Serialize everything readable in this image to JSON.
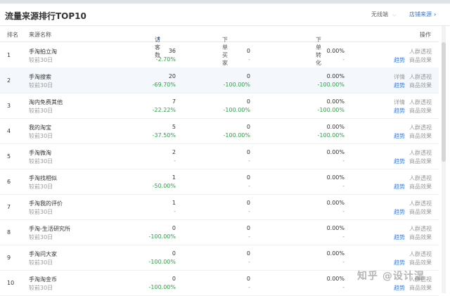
{
  "header": {
    "title": "流量来源排行TOP10",
    "device_select": "无线端",
    "shop_source_link": "店铺来源"
  },
  "columns": {
    "rank": "排名",
    "source": "来源名称",
    "visitors": "访客数",
    "buyers": "下单买家数",
    "conversion": "下单转化率",
    "action": "操作"
  },
  "actions": {
    "detail": "详情",
    "trend": "趋势",
    "crowd": "人群透视",
    "effect": "商品效果"
  },
  "compare_label": "较前30日",
  "rows": [
    {
      "rank": "1",
      "name": "手淘拍立淘",
      "visitors": "36",
      "visitors_chg": "-2.70%",
      "buyers": "0",
      "buyers_chg": "-",
      "conv": "0.00%",
      "conv_chg": "-",
      "has_detail": false
    },
    {
      "rank": "2",
      "name": "手淘搜索",
      "visitors": "20",
      "visitors_chg": "-69.70%",
      "buyers": "0",
      "buyers_chg": "-100.00%",
      "conv": "0.00%",
      "conv_chg": "-100.00%",
      "has_detail": true
    },
    {
      "rank": "3",
      "name": "淘内免费其他",
      "visitors": "7",
      "visitors_chg": "-22.22%",
      "buyers": "0",
      "buyers_chg": "-100.00%",
      "conv": "0.00%",
      "conv_chg": "-100.00%",
      "has_detail": true
    },
    {
      "rank": "4",
      "name": "我的淘宝",
      "visitors": "5",
      "visitors_chg": "-37.50%",
      "buyers": "0",
      "buyers_chg": "-100.00%",
      "conv": "0.00%",
      "conv_chg": "-100.00%",
      "has_detail": false
    },
    {
      "rank": "5",
      "name": "手淘微淘",
      "visitors": "2",
      "visitors_chg": "-",
      "buyers": "0",
      "buyers_chg": "-",
      "conv": "0.00%",
      "conv_chg": "-",
      "has_detail": false
    },
    {
      "rank": "6",
      "name": "手淘找相似",
      "visitors": "1",
      "visitors_chg": "-50.00%",
      "buyers": "0",
      "buyers_chg": "-",
      "conv": "0.00%",
      "conv_chg": "-",
      "has_detail": false
    },
    {
      "rank": "7",
      "name": "手淘我的评价",
      "visitors": "1",
      "visitors_chg": "-",
      "buyers": "0",
      "buyers_chg": "-",
      "conv": "0.00%",
      "conv_chg": "-",
      "has_detail": false
    },
    {
      "rank": "8",
      "name": "手淘-生活研究所",
      "visitors": "0",
      "visitors_chg": "-100.00%",
      "buyers": "0",
      "buyers_chg": "-",
      "conv": "0.00%",
      "conv_chg": "-",
      "has_detail": false
    },
    {
      "rank": "9",
      "name": "手淘问大家",
      "visitors": "0",
      "visitors_chg": "-100.00%",
      "buyers": "0",
      "buyers_chg": "-",
      "conv": "0.00%",
      "conv_chg": "-",
      "has_detail": false
    },
    {
      "rank": "10",
      "name": "手淘淘金币",
      "visitors": "0",
      "visitors_chg": "-100.00%",
      "buyers": "0",
      "buyers_chg": "-",
      "conv": "0.00%",
      "conv_chg": "-",
      "has_detail": false
    }
  ],
  "watermark": "知乎 @设计湿",
  "colors": {
    "accent": "#3a7bd5",
    "negative": "#2aa346",
    "highlight_row": "#f4f8fc"
  },
  "icons": {
    "sort_active": "sort-desc-icon",
    "sort_inactive": "sort-icon",
    "device_dropdown": "chevron-down-icon",
    "shop_link": "chevron-right-icon"
  }
}
